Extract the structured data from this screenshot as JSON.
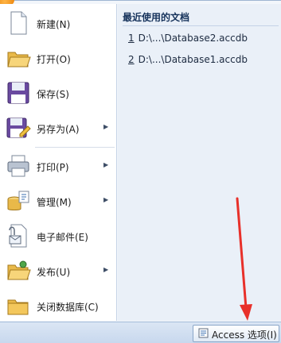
{
  "menu": {
    "items": [
      {
        "label": "新建(N)",
        "icon": "new-document-icon",
        "has_submenu": false
      },
      {
        "label": "打开(O)",
        "icon": "open-folder-icon",
        "has_submenu": false
      },
      {
        "label": "保存(S)",
        "icon": "save-disk-icon",
        "has_submenu": false
      },
      {
        "label": "另存为(A)",
        "icon": "save-as-icon",
        "has_submenu": true
      },
      {
        "label": "打印(P)",
        "icon": "printer-icon",
        "has_submenu": true
      },
      {
        "label": "管理(M)",
        "icon": "manage-database-icon",
        "has_submenu": true
      },
      {
        "label": "电子邮件(E)",
        "icon": "email-icon",
        "has_submenu": false
      },
      {
        "label": "发布(U)",
        "icon": "publish-folder-icon",
        "has_submenu": true
      },
      {
        "label": "关闭数据库(C)",
        "icon": "close-database-icon",
        "has_submenu": false
      }
    ],
    "submenu_arrow": "▶"
  },
  "recent": {
    "title": "最近使用的文档",
    "items": [
      {
        "num": "1",
        "path": "D:\\...\\Database2.accdb"
      },
      {
        "num": "2",
        "path": "D:\\...\\Database1.accdb"
      }
    ]
  },
  "bottom": {
    "options_label": "Access 选项(I)",
    "options_icon": "options-settings-icon"
  },
  "annotation": {
    "arrow_color": "#e8302a"
  }
}
